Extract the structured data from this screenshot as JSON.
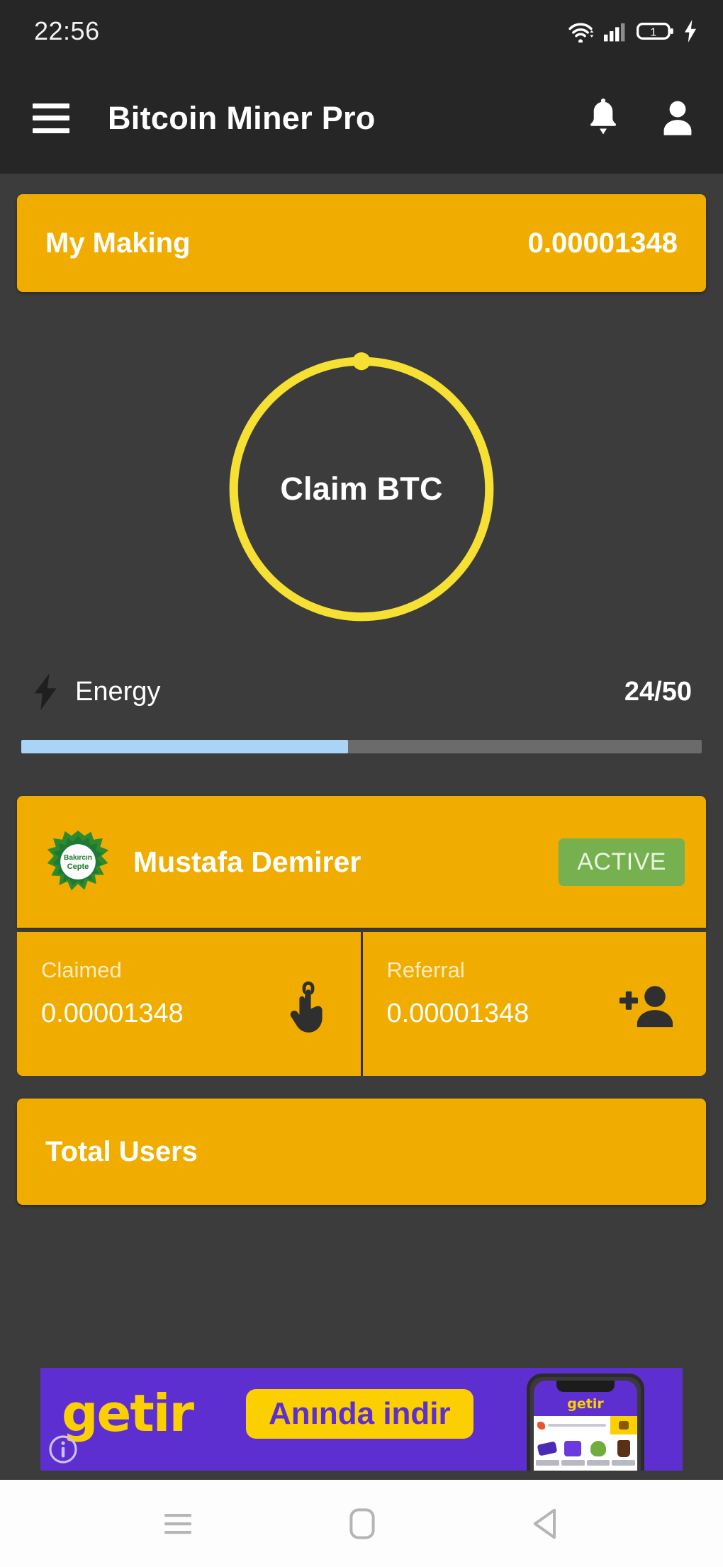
{
  "status_bar": {
    "time": "22:56",
    "icons": [
      "wifi-icon",
      "cellular-signal-icon",
      "battery-icon",
      "charging-bolt-icon"
    ],
    "battery_text": "1"
  },
  "app_bar": {
    "menu_icon": "hamburger-menu-icon",
    "title": "Bitcoin Miner Pro",
    "notification_icon": "bell-icon",
    "profile_icon": "person-icon"
  },
  "my_making": {
    "label": "My Making",
    "value": "0.00001348"
  },
  "claim": {
    "label": "Claim BTC",
    "ring_color": "#f5e033",
    "progress_dot": true
  },
  "energy": {
    "icon": "lightning-bolt-icon",
    "label": "Energy",
    "current": 24,
    "max": 50,
    "display": "24/50",
    "percent": 48,
    "fill_color": "#a9d4f5",
    "track_color": "#6b6b6b"
  },
  "profile": {
    "avatar_icon": "green-splatter-logo-avatar",
    "avatar_text": "Bakırcın Cepte",
    "name": "Mustafa Demirer",
    "status": "ACTIVE",
    "status_color": "#76b04f"
  },
  "stats": [
    {
      "label": "Claimed",
      "value": "0.00001348",
      "icon": "tap-hand-icon"
    },
    {
      "label": "Referral",
      "value": "0.00001348",
      "icon": "person-add-icon"
    }
  ],
  "total_users": {
    "label": "Total Users"
  },
  "ad": {
    "brand": "getir",
    "cta": "Anında indir",
    "phone_brand": "getir",
    "info_icon": "ad-info-icon",
    "background_color": "#5d2fd0",
    "accent_color": "#fcd000"
  },
  "system_nav": {
    "recents_icon": "recents-icon",
    "home_icon": "home-icon",
    "back_icon": "back-icon"
  },
  "theme": {
    "background": "#3c3c3c",
    "bar_background": "#262626",
    "card_gold": "#f0ad00"
  }
}
